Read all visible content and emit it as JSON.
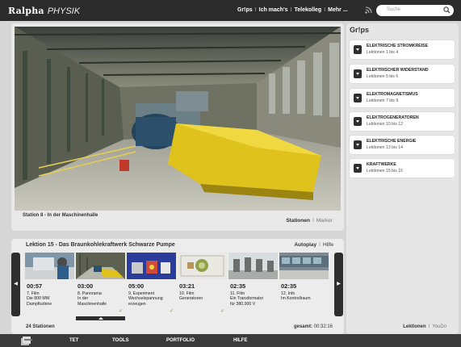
{
  "header": {
    "brand": "Ralpha",
    "subject": "PHYSIK",
    "nav": [
      "Gr!ps",
      "Ich mach's",
      "Telekolleg",
      "Mehr ..."
    ],
    "nav_separator": "I",
    "search_placeholder": "Suche"
  },
  "player": {
    "station_title": "Station 8 - In der Maschinenhalle",
    "links": {
      "stationen": "Stationen",
      "marker": "Marker",
      "sep": "I"
    }
  },
  "sidebar": {
    "title": "Gr!ps",
    "lessons": [
      {
        "title": "ELEKTRISCHE STROMKREISE",
        "sub": "Lektionen 1 bis 4"
      },
      {
        "title": "ELEKTRISCHER WIDERSTAND",
        "sub": "Lektionen 5 bis 6"
      },
      {
        "title": "ELEKTROMAGNETISMUS",
        "sub": "Lektionen 7 bis 9"
      },
      {
        "title": "ELEKTROGENERATOREN",
        "sub": "Lektionen 10 bis 12"
      },
      {
        "title": "ELEKTRISCHE ENERGIE",
        "sub": "Lektionen 13 bis 14"
      },
      {
        "title": "KRAFTWERKE",
        "sub": "Lektionen 15 bis 16"
      }
    ],
    "footer": {
      "lektionen": "Lektionen",
      "youdo": "YouDo",
      "sep": "I"
    }
  },
  "lesson": {
    "title": "Lektion 15 - Das Braunkohlekraftwerk Schwarze Pumpe",
    "autoplay": "Autoplay",
    "hilfe": "Hilfe",
    "sep": "I",
    "tiles": [
      {
        "time": "00:57",
        "line1": "7. Film",
        "line2": "Die 800 MW",
        "line3": "Dampfturbine",
        "checked": false
      },
      {
        "time": "03:00",
        "line1": "8. Panorama",
        "line2": "In der",
        "line3": "Maschinenhalle",
        "checked": true
      },
      {
        "time": "05:00",
        "line1": "9. Experiment",
        "line2": "Wechselspannung",
        "line3": "erzeugen",
        "checked": true
      },
      {
        "time": "03:21",
        "line1": "10. Film",
        "line2": "Generatoren",
        "line3": "",
        "checked": true
      },
      {
        "time": "02:35",
        "line1": "11. Film",
        "line2": "Ein Transformator",
        "line3": "für 380.000 V",
        "checked": false
      },
      {
        "time": "02:35",
        "line1": "12. Info",
        "line2": "Im Kontrollraum",
        "line3": "",
        "checked": false
      }
    ],
    "stations_count": "24 Stationen",
    "total_label": "gesamt:",
    "total_value": "00:32:16"
  },
  "bottom_nav": [
    "TET",
    "TOOLS",
    "PORTFOLIO",
    "HILFE"
  ],
  "colors": {
    "topbar": "#2b2b2b",
    "turbine_yellow": "#e0c21c",
    "check_green": "#8db24a"
  }
}
